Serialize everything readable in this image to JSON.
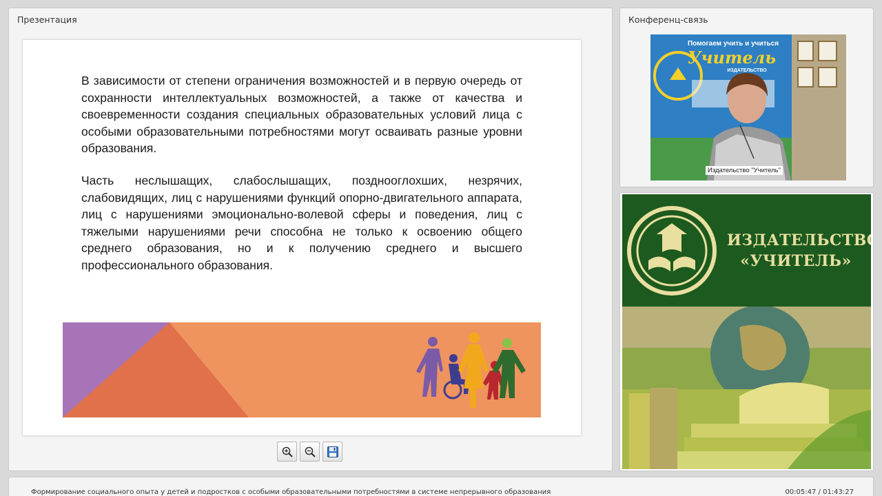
{
  "presentation": {
    "title": "Презентация",
    "slide": {
      "paragraph1": "В зависимости от степени ограничения возможностей и в первую очередь от сохранности интеллектуальных возможностей, а также от качества и своевременности создания специальных образовательных условий лица с особыми образовательными потребностями могут осваивать разные уровни образования.",
      "paragraph2": "Часть неслышащих, слабослышащих, позднооглохших, незрячих, слабовидящих, лиц с нарушениями функций опорно-двигательного аппарата, лиц с нарушениями эмоционально-волевой сферы и поведения, лиц с тяжелыми нарушениями речи способна не только к освоению общего среднего образования, но и к получению среднего и высшего профессионального образования."
    },
    "toolbar": {
      "zoom_in_icon": "zoom-in-icon",
      "zoom_out_icon": "zoom-out-icon",
      "save_icon": "floppy-disk-icon"
    }
  },
  "conference": {
    "title": "Конференц-связь",
    "video_label": "Издательство \"Учитель\"",
    "poster_line1": "Помогаем учить и учиться",
    "poster_brand": "Учитель",
    "poster_sub": "ИЗДАТЕЛЬСТВО"
  },
  "publisher": {
    "name_line1": "ИЗДАТЕЛЬСТВО",
    "name_line2": "«УЧИТЕЛЬ»"
  },
  "footer": {
    "course_title": "Формирование социального опыта у детей и подростков с особыми образовательными потребностями в системе непрерывного образования",
    "time": "00:05:47 / 01:43:27"
  },
  "colors": {
    "accent_green": "#1c5a1f",
    "banner_orange": "#ef935f",
    "banner_purple": "#a874b8"
  }
}
